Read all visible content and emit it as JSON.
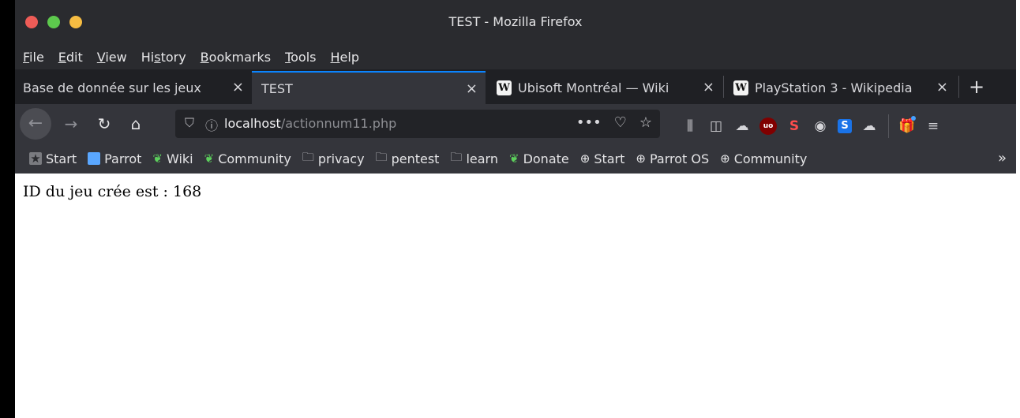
{
  "window": {
    "title": "TEST - Mozilla Firefox"
  },
  "menu": {
    "items": [
      {
        "acc": "F",
        "rest": "ile"
      },
      {
        "acc": "E",
        "rest": "dit"
      },
      {
        "acc": "V",
        "rest": "iew"
      },
      {
        "pre": "Hi",
        "acc": "s",
        "rest": "tory"
      },
      {
        "acc": "B",
        "rest": "ookmarks"
      },
      {
        "acc": "T",
        "rest": "ools"
      },
      {
        "acc": "H",
        "rest": "elp"
      }
    ]
  },
  "tabs": [
    {
      "label": "Base de donnée sur les jeux",
      "active": false
    },
    {
      "label": "TEST",
      "active": true
    },
    {
      "label": "Ubisoft Montréal — Wiki",
      "active": false,
      "favicon": "wikipedia-icon"
    },
    {
      "label": "PlayStation 3 - Wikipedia",
      "active": false,
      "favicon": "wikipedia-icon"
    }
  ],
  "tab_close_glyph": "×",
  "wiki_glyph": "W",
  "new_tab_glyph": "+",
  "nav": {
    "url_host": "localhost",
    "url_path": "/actionnum11.php",
    "page_actions_glyph": "•••"
  },
  "bookmarks": [
    {
      "label": "Start",
      "icon": "star-box-icon"
    },
    {
      "label": "Parrot",
      "icon": "parrot-icon"
    },
    {
      "label": "Wiki",
      "icon": "leaf-icon"
    },
    {
      "label": "Community",
      "icon": "leaf-icon"
    },
    {
      "label": "privacy",
      "icon": "folder-icon"
    },
    {
      "label": "pentest",
      "icon": "folder-icon"
    },
    {
      "label": "learn",
      "icon": "folder-icon"
    },
    {
      "label": "Donate",
      "icon": "leaf-icon"
    },
    {
      "label": "Start",
      "icon": "globe-icon"
    },
    {
      "label": "Parrot OS",
      "icon": "globe-icon"
    },
    {
      "label": "Community",
      "icon": "globe-icon"
    }
  ],
  "bookmarks_overflow_glyph": "»",
  "page": {
    "text": "ID du jeu crée est : 168"
  },
  "colors": {
    "titlebar": "#2a2b2f",
    "tabstrip": "#1f2024",
    "toolbar": "#34353b",
    "accent": "#0a84ff",
    "traffic_close": "#ee5c57",
    "traffic_max": "#5dc94d",
    "traffic_min": "#f6bc42"
  }
}
